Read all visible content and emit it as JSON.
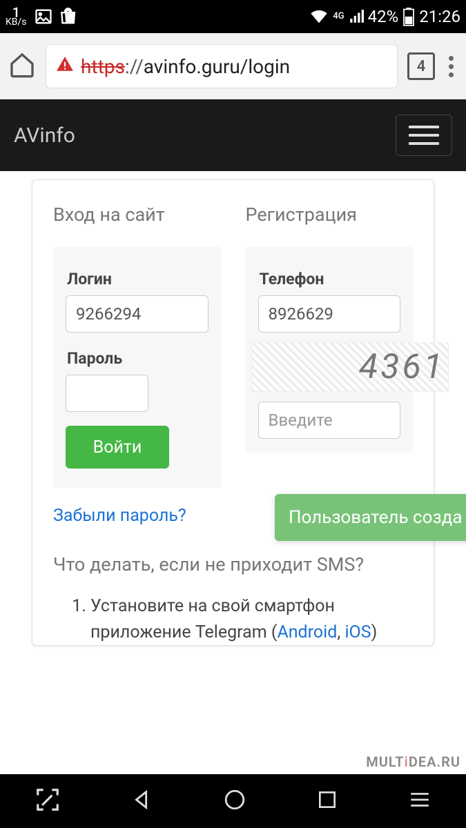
{
  "status_bar": {
    "speed_value": "1",
    "speed_unit": "KB/s",
    "network_label": "4G",
    "battery_pct": "42%",
    "time": "21:26"
  },
  "browser": {
    "url_scheme": "https",
    "url_sep": "://",
    "url_host": "avinfo.guru",
    "url_path": "/login",
    "tab_count": "4"
  },
  "page_header": {
    "brand": "AVinfo"
  },
  "login": {
    "section_title": "Вход на сайт",
    "login_label": "Логин",
    "login_value": "9266294",
    "password_label": "Пароль",
    "password_value": "",
    "submit_label": "Войти",
    "forgot_label": "Забыли пароль?"
  },
  "register": {
    "section_title": "Регистрация",
    "phone_label": "Телефон",
    "phone_value": "8926629",
    "captcha_text": "4361",
    "captcha_placeholder": "Введите"
  },
  "toast": {
    "message": "Пользователь созда"
  },
  "sms_help": {
    "title": "Что делать, если не приходит SMS?",
    "step1_a": "Установите на свой смартфон приложение Telegram (",
    "step1_android": "Android",
    "step1_sep": ", ",
    "step1_ios": "iOS",
    "step1_b": ")"
  },
  "watermark": {
    "part1": "MULT",
    "part2": "i",
    "part3": "DEA",
    "part4": ".RU"
  }
}
